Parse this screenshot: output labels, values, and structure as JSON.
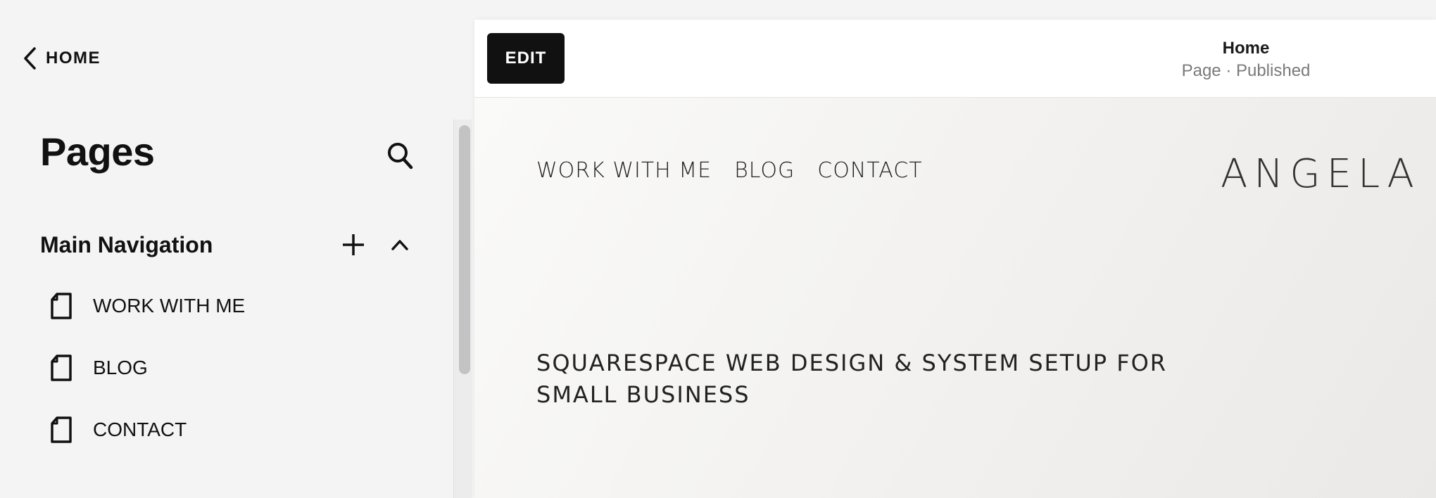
{
  "sidebar": {
    "back_label": "HOME",
    "title": "Pages",
    "section_heading": "Main Navigation",
    "items": [
      {
        "label": "WORK WITH ME",
        "icon": "page-icon"
      },
      {
        "label": "BLOG",
        "icon": "page-icon"
      },
      {
        "label": "CONTACT",
        "icon": "page-icon"
      }
    ]
  },
  "toolbar": {
    "edit_label": "EDIT",
    "page_title": "Home",
    "page_status": "Page · Published"
  },
  "site": {
    "nav": [
      "WORK WITH ME",
      "BLOG",
      "CONTACT"
    ],
    "logo": "ANGELA HOPE",
    "hero": "SQUARESPACE WEB DESIGN & SYSTEM SETUP FOR SMALL BUSINESS"
  },
  "colors": {
    "sidebar_bg": "#f4f4f4",
    "edit_button_bg": "#111111",
    "status_text": "#7a7a7a",
    "scroll_thumb": "#c3c3c3"
  }
}
